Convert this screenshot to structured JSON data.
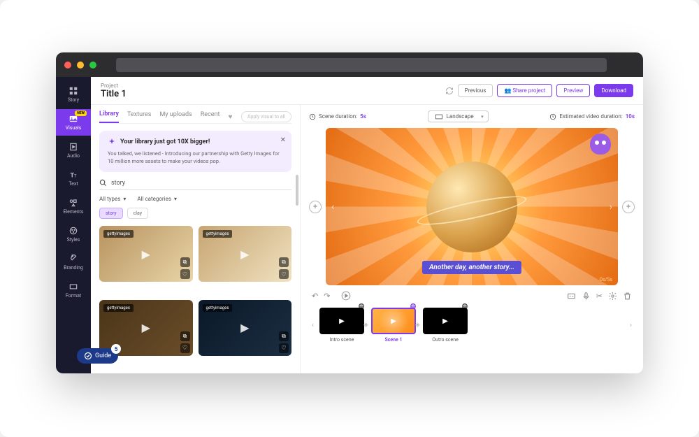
{
  "header": {
    "project_label": "Project",
    "title": "Title 1",
    "previous": "Previous",
    "share": "Share project",
    "preview": "Preview",
    "download": "Download"
  },
  "sidebar": {
    "items": [
      {
        "label": "Story"
      },
      {
        "label": "Visuals",
        "badge": "NEW"
      },
      {
        "label": "Audio"
      },
      {
        "label": "Text"
      },
      {
        "label": "Elements"
      },
      {
        "label": "Styles"
      },
      {
        "label": "Branding"
      },
      {
        "label": "Format"
      }
    ]
  },
  "guide": {
    "label": "Guide",
    "count": "5"
  },
  "library": {
    "tabs": [
      "Library",
      "Textures",
      "My uploads",
      "Recent"
    ],
    "apply_all": "Apply visual to all",
    "banner_title": "Your library just got 10X bigger!",
    "banner_body": "You talked, we listened - Introducing our partnership with Getty Images for 10 million more assets to make your videos pop.",
    "search_value": "story",
    "filter_types": "All types",
    "filter_cats": "All categories",
    "chips": [
      "story",
      "clay"
    ],
    "thumb_tags": [
      "gettyimages",
      "gettyimages",
      "gettyimages",
      "gettyimages"
    ]
  },
  "preview": {
    "scene_duration_label": "Scene duration:",
    "scene_duration": "5s",
    "aspect": "Landscape",
    "est_label": "Estimated video duration:",
    "est_value": "10s",
    "caption": "Another day, another story...",
    "time": "0s/5s"
  },
  "timeline": {
    "scenes": [
      {
        "label": "Intro scene"
      },
      {
        "label": "Scene 1"
      },
      {
        "label": "Outro scene"
      }
    ]
  }
}
